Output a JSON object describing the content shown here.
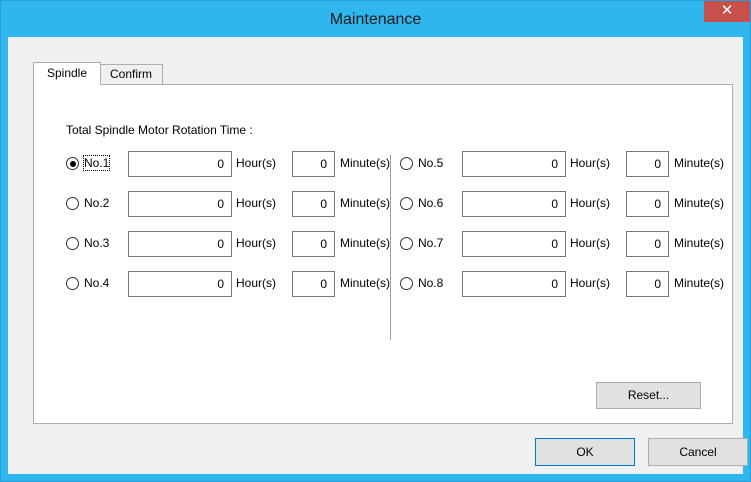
{
  "window": {
    "title": "Maintenance",
    "close_glyph": "✕"
  },
  "tabs": [
    {
      "label": "Spindle",
      "active": true
    },
    {
      "label": "Confirm",
      "active": false
    }
  ],
  "spindle": {
    "group_label": "Total Spindle Motor Rotation Time :",
    "hour_unit": "Hour(s)",
    "minute_unit": "Minute(s)",
    "spindles": [
      {
        "label": "No.1",
        "hours": "0",
        "minutes": "0",
        "selected": true
      },
      {
        "label": "No.2",
        "hours": "0",
        "minutes": "0",
        "selected": false
      },
      {
        "label": "No.3",
        "hours": "0",
        "minutes": "0",
        "selected": false
      },
      {
        "label": "No.4",
        "hours": "0",
        "minutes": "0",
        "selected": false
      },
      {
        "label": "No.5",
        "hours": "0",
        "minutes": "0",
        "selected": false
      },
      {
        "label": "No.6",
        "hours": "0",
        "minutes": "0",
        "selected": false
      },
      {
        "label": "No.7",
        "hours": "0",
        "minutes": "0",
        "selected": false
      },
      {
        "label": "No.8",
        "hours": "0",
        "minutes": "0",
        "selected": false
      }
    ],
    "reset_label": "Reset..."
  },
  "footer": {
    "ok_label": "OK",
    "cancel_label": "Cancel"
  },
  "colors": {
    "title_bar": "#2fb6ee",
    "close_button": "#c7504b",
    "client_background": "#f0f0f0"
  }
}
